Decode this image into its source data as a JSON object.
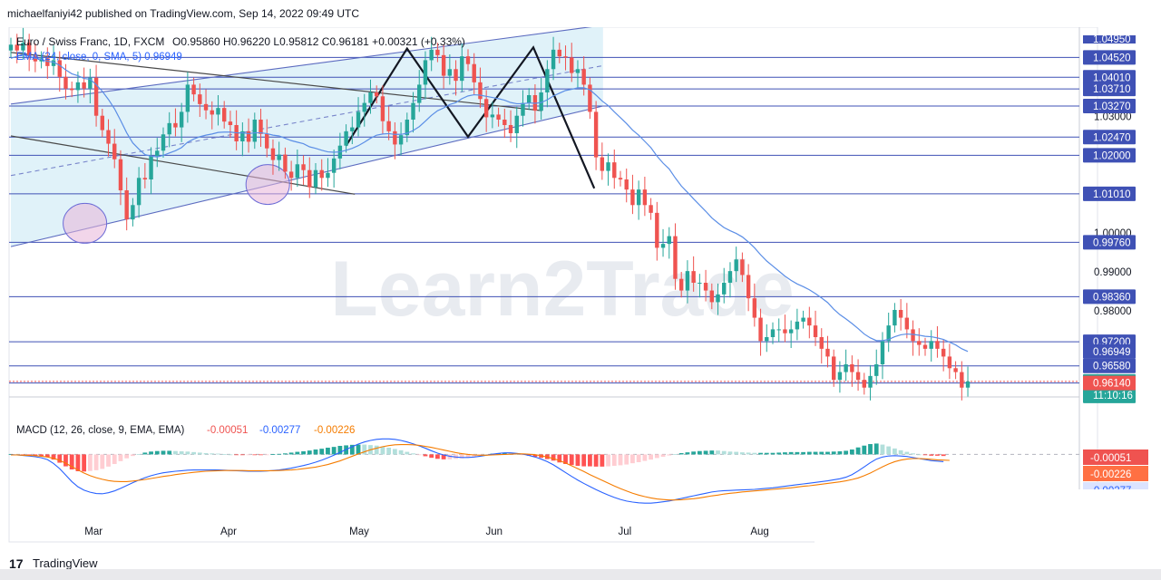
{
  "header": {
    "published": "michaelfaniyi42 published on TradingView.com, Sep 14, 2022 09:49 UTC"
  },
  "footer": {
    "logo": "17",
    "brand": "TradingView"
  },
  "watermark": "Learn2Trade",
  "legend": {
    "symbol": "Euro / Swiss Franc, 1D, FXCM",
    "ohlc": "O0.95860 H0.96220 L0.95812 C0.96181 +0.00321 (+0.33%)",
    "ema": "EMA (24, close, 0, SMA, 5) 0.96949",
    "macd_label": "MACD (12, 26, close, 9, EMA, EMA)",
    "macd_vals": [
      "-0.00051",
      "-0.00277",
      "-0.00226"
    ]
  },
  "colors": {
    "up": "#26a69a",
    "down": "#ef5350",
    "ema": "#5b8ee6",
    "hline": "#3f51b5",
    "channel": "#d6eef7",
    "macd": "#2962ff",
    "signal": "#f57c00"
  },
  "chart_data": [
    {
      "type": "candlestick",
      "title": "Euro / Swiss Franc, 1D, FXCM",
      "currency": "CHF",
      "ylim": [
        0.955,
        1.053
      ],
      "x_labels": [
        "Mar",
        "Apr",
        "May",
        "Jun",
        "Jul",
        "Aug"
      ],
      "x_start": "2022-02-10",
      "y_ticks": [
        1.03,
        1.0,
        0.99,
        0.98
      ],
      "price_levels": [
        1.0452,
        1.0401,
        1.0371,
        1.0327,
        1.0247,
        1.02,
        1.0101,
        0.9976,
        0.9836,
        0.972,
        0.9658,
        0.9614
      ],
      "badges": [
        {
          "label": "1.04950",
          "value": 1.0495,
          "cut": true
        },
        {
          "label": "1.04520",
          "value": 1.0452
        },
        {
          "label": "1.04010",
          "value": 1.0401
        },
        {
          "label": "1.03710",
          "value": 1.0371
        },
        {
          "label": "1.03270",
          "value": 1.0327
        },
        {
          "label": "1.02470",
          "value": 1.0247
        },
        {
          "label": "1.02000",
          "value": 1.02
        },
        {
          "label": "1.01010",
          "value": 1.0101
        },
        {
          "label": "0.99760",
          "value": 0.9976
        },
        {
          "label": "0.98360",
          "value": 0.9836
        },
        {
          "label": "0.97200",
          "value": 0.972
        },
        {
          "label": "0.96949",
          "value": 0.96949
        },
        {
          "label": "0.96580",
          "value": 0.9658
        },
        {
          "label": "0.96181",
          "value": 0.96181,
          "sub": "11:10:16",
          "style": "last"
        },
        {
          "label": "0.96140",
          "value": 0.9614,
          "style": "red"
        }
      ],
      "tick_labels": [
        {
          "label": "1.03000",
          "value": 1.03
        },
        {
          "label": "1.00000",
          "value": 1.0
        },
        {
          "label": "0.99000",
          "value": 0.99
        },
        {
          "label": "0.98000",
          "value": 0.98
        }
      ],
      "closes": [
        1.0485,
        1.047,
        1.049,
        1.0455,
        1.0442,
        1.045,
        1.043,
        1.0445,
        1.0402,
        1.0372,
        1.0368,
        1.0388,
        1.0372,
        1.04,
        1.0302,
        1.0265,
        1.023,
        1.019,
        1.011,
        1.0035,
        1.0072,
        1.0142,
        1.0138,
        1.0198,
        1.0212,
        1.0254,
        1.0283,
        1.0272,
        1.0312,
        1.0382,
        1.0357,
        1.0332,
        1.0316,
        1.0305,
        1.0322,
        1.0287,
        1.0278,
        1.0236,
        1.0262,
        1.0235,
        1.0292,
        1.0255,
        1.0218,
        1.0188,
        1.0202,
        1.0158,
        1.0142,
        1.0177,
        1.0162,
        1.0118,
        1.0162,
        1.0142,
        1.0155,
        1.0192,
        1.0225,
        1.0262,
        1.0272,
        1.0312,
        1.0335,
        1.0362,
        1.0352,
        1.0288,
        1.0262,
        1.0228,
        1.0252,
        1.0292,
        1.0335,
        1.0382,
        1.0445,
        1.0472,
        1.0458,
        1.0405,
        1.0422,
        1.0392,
        1.0455,
        1.0435,
        1.0388,
        1.0345,
        1.0298,
        1.0305,
        1.0292,
        1.0278,
        1.0257,
        1.0302,
        1.0335,
        1.0355,
        1.0315,
        1.0362,
        1.0422,
        1.0472,
        1.0455,
        1.0452,
        1.0412,
        1.0422,
        1.0382,
        1.0312,
        1.0195,
        1.016,
        1.0182,
        1.0142,
        1.0138,
        1.0112,
        1.0072,
        1.0112,
        1.0072,
        1.0052,
        0.9962,
        0.9972,
        0.9992,
        0.9882,
        0.9852,
        0.9902,
        0.9872,
        0.9872,
        0.9852,
        0.9822,
        0.9842,
        0.9872,
        0.9902,
        0.9932,
        0.9892,
        0.9832,
        0.9782,
        0.9722,
        0.9732,
        0.9752,
        0.9752,
        0.9742,
        0.9752,
        0.9772,
        0.9782,
        0.9762,
        0.9732,
        0.9702,
        0.9682,
        0.9622,
        0.9642,
        0.9662,
        0.9642,
        0.9622,
        0.9602,
        0.9632,
        0.9662,
        0.9722,
        0.9762,
        0.9802,
        0.9782,
        0.9752,
        0.9722,
        0.9712,
        0.9702,
        0.9722,
        0.9702,
        0.9682,
        0.9652,
        0.9642,
        0.9602,
        0.9618
      ],
      "ema": [
        1.045,
        1.0455,
        1.046,
        1.0455,
        1.045,
        1.0447,
        1.0442,
        1.044,
        1.0432,
        1.042,
        1.041,
        1.0405,
        1.0398,
        1.0396,
        1.0382,
        1.0365,
        1.0344,
        1.032,
        1.029,
        1.0258,
        1.0232,
        1.0216,
        1.0202,
        1.0198,
        1.0196,
        1.02,
        1.0206,
        1.0212,
        1.022,
        1.0234,
        1.0242,
        1.0248,
        1.0252,
        1.0255,
        1.0259,
        1.026,
        1.026,
        1.0258,
        1.0258,
        1.0256,
        1.0258,
        1.0258,
        1.0256,
        1.0252,
        1.025,
        1.0244,
        1.0238,
        1.0234,
        1.023,
        1.0222,
        1.0218,
        1.0213,
        1.0209,
        1.0208,
        1.0209,
        1.0213,
        1.0218,
        1.0225,
        1.0234,
        1.0244,
        1.0252,
        1.0255,
        1.0256,
        1.0254,
        1.0254,
        1.0257,
        1.0264,
        1.0274,
        1.0288,
        1.0303,
        1.0315,
        1.0322,
        1.0331,
        1.0336,
        1.0346,
        1.0353,
        1.0356,
        1.0355,
        1.0352,
        1.0349,
        1.0346,
        1.0342,
        1.0336,
        1.0333,
        1.0333,
        1.0335,
        1.0334,
        1.0336,
        1.0343,
        1.0353,
        1.036,
        1.0367,
        1.037,
        1.0374,
        1.0374,
        1.0369,
        1.0355,
        1.034,
        1.0328,
        1.0312,
        1.0297,
        1.0282,
        1.0265,
        1.0252,
        1.0236,
        1.022,
        1.0198,
        1.018,
        1.0165,
        1.0142,
        1.0121,
        1.0105,
        1.0088,
        1.0072,
        1.0056,
        1.0039,
        1.0026,
        1.0014,
        1.0006,
        0.9999,
        0.999,
        0.9977,
        0.9962,
        0.9944,
        0.9928,
        0.9915,
        0.9902,
        0.9889,
        0.9878,
        0.9869,
        0.9862,
        0.9854,
        0.9844,
        0.9833,
        0.9821,
        0.9804,
        0.979,
        0.9779,
        0.9767,
        0.9754,
        0.974,
        0.973,
        0.9723,
        0.9723,
        0.9726,
        0.9733,
        0.9738,
        0.974,
        0.9739,
        0.9737,
        0.9734,
        0.9733,
        0.973,
        0.9726,
        0.9719,
        0.9712,
        0.9702,
        0.9695
      ],
      "annotations": {
        "channel_upper": [
          [
            "2022-02-10",
            1.0332
          ],
          [
            "2022-06-26",
            1.0535
          ]
        ],
        "channel_lower": [
          [
            "2022-02-10",
            0.9965
          ],
          [
            "2022-06-26",
            1.0327
          ]
        ],
        "channel_mid": [
          [
            "2022-02-10",
            1.0148
          ],
          [
            "2022-06-26",
            1.0431
          ]
        ],
        "trend_down": [
          [
            "2022-02-10",
            1.025
          ],
          [
            "2022-04-30",
            1.01
          ]
        ],
        "trend_top": [
          [
            "2022-02-10",
            1.0465
          ],
          [
            "2022-06-12",
            1.0315
          ]
        ],
        "circles": [
          {
            "x": "2022-02-27",
            "y": 1.0025
          },
          {
            "x": "2022-04-10",
            "y": 1.0125
          }
        ],
        "zigzag": [
          [
            "2022-04-28",
            1.0225
          ],
          [
            "2022-05-12",
            1.0475
          ],
          [
            "2022-05-26",
            1.0248
          ],
          [
            "2022-06-10",
            1.0478
          ],
          [
            "2022-06-24",
            1.0115
          ]
        ]
      }
    },
    {
      "type": "macd",
      "title": "MACD (12, 26, close, 9, EMA, EMA)",
      "ylim": [
        -0.024,
        0.011
      ],
      "badges": [
        {
          "label": "-0.00051",
          "value": -0.00051,
          "style": "down"
        },
        {
          "label": "-0.00226",
          "value": -0.00226,
          "style": "orange"
        },
        {
          "label": "-0.00277",
          "value": -0.00277,
          "style": "blue"
        }
      ],
      "macd": [
        -0.0001,
        -0.0002,
        -0.0004,
        -0.0006,
        -0.0009,
        -0.0013,
        -0.002,
        -0.0035,
        -0.0055,
        -0.008,
        -0.0105,
        -0.0125,
        -0.0138,
        -0.0146,
        -0.0151,
        -0.0152,
        -0.0148,
        -0.0141,
        -0.0131,
        -0.012,
        -0.0109,
        -0.0099,
        -0.009,
        -0.0082,
        -0.0076,
        -0.0071,
        -0.0068,
        -0.0065,
        -0.0063,
        -0.0061,
        -0.006,
        -0.006,
        -0.006,
        -0.006,
        -0.006,
        -0.0061,
        -0.0062,
        -0.0063,
        -0.0064,
        -0.0065,
        -0.0065,
        -0.0065,
        -0.0064,
        -0.0062,
        -0.006,
        -0.0057,
        -0.0053,
        -0.0048,
        -0.0043,
        -0.0037,
        -0.003,
        -0.0022,
        -0.0013,
        -0.0003,
        0.0008,
        0.0019,
        0.003,
        0.004,
        0.0048,
        0.0054,
        0.0058,
        0.006,
        0.006,
        0.0058,
        0.0054,
        0.0048,
        0.0041,
        0.0033,
        0.0024,
        0.0014,
        0.0005,
        -0.0002,
        -0.0007,
        -0.001,
        -0.0012,
        -0.0012,
        -0.001,
        -0.0007,
        -0.0003,
        0.0001,
        0.0004,
        0.0006,
        0.0006,
        0.0004,
        0.0001,
        -0.0004,
        -0.001,
        -0.0018,
        -0.0028,
        -0.004,
        -0.0055,
        -0.007,
        -0.0085,
        -0.0099,
        -0.0112,
        -0.0124,
        -0.0136,
        -0.0147,
        -0.0157,
        -0.0166,
        -0.0174,
        -0.018,
        -0.0184,
        -0.0187,
        -0.0188,
        -0.0188,
        -0.0186,
        -0.0183,
        -0.018,
        -0.0175,
        -0.017,
        -0.0165,
        -0.016,
        -0.0155,
        -0.015,
        -0.0145,
        -0.0142,
        -0.014,
        -0.0139,
        -0.0138,
        -0.0137,
        -0.0136,
        -0.0135,
        -0.0133,
        -0.0131,
        -0.0129,
        -0.0126,
        -0.0123,
        -0.012,
        -0.0117,
        -0.0114,
        -0.0111,
        -0.0108,
        -0.0105,
        -0.0102,
        -0.0098,
        -0.0094,
        -0.0088,
        -0.0078,
        -0.0064,
        -0.0048,
        -0.0032,
        -0.0018,
        -0.001,
        -0.0006,
        -0.0005,
        -0.0006,
        -0.0008,
        -0.0012,
        -0.0016,
        -0.002,
        -0.0024,
        -0.0026,
        -0.0028
      ],
      "signal": [
        -0.0002,
        -0.0002,
        -0.0003,
        -0.0004,
        -0.0005,
        -0.0007,
        -0.001,
        -0.0015,
        -0.0023,
        -0.0034,
        -0.0047,
        -0.006,
        -0.0072,
        -0.0082,
        -0.009,
        -0.0096,
        -0.0101,
        -0.0104,
        -0.0105,
        -0.0105,
        -0.0103,
        -0.01,
        -0.0097,
        -0.0093,
        -0.0089,
        -0.0085,
        -0.0082,
        -0.0078,
        -0.0075,
        -0.0072,
        -0.0069,
        -0.0067,
        -0.0065,
        -0.0064,
        -0.0063,
        -0.0062,
        -0.0062,
        -0.0062,
        -0.0062,
        -0.0063,
        -0.0063,
        -0.0063,
        -0.0063,
        -0.0063,
        -0.0062,
        -0.0061,
        -0.006,
        -0.0058,
        -0.0055,
        -0.0052,
        -0.0049,
        -0.0044,
        -0.0039,
        -0.0032,
        -0.0025,
        -0.0016,
        -0.0007,
        0.0002,
        0.001,
        0.0018,
        0.0024,
        0.003,
        0.0034,
        0.0037,
        0.0038,
        0.0038,
        0.0037,
        0.0035,
        0.0031,
        0.0027,
        0.0022,
        0.0017,
        0.0012,
        0.0007,
        0.0003,
        0.0,
        -0.0002,
        -0.0003,
        -0.0003,
        -0.0002,
        -0.0001,
        0.0,
        0.0001,
        0.0002,
        0.0002,
        0.0001,
        -0.0001,
        -0.0005,
        -0.001,
        -0.0016,
        -0.0024,
        -0.0033,
        -0.0044,
        -0.0055,
        -0.0066,
        -0.0078,
        -0.0089,
        -0.01,
        -0.0111,
        -0.0122,
        -0.0132,
        -0.0141,
        -0.015,
        -0.0157,
        -0.0163,
        -0.0168,
        -0.0172,
        -0.0174,
        -0.0176,
        -0.0176,
        -0.0175,
        -0.0173,
        -0.0171,
        -0.0168,
        -0.0164,
        -0.016,
        -0.0157,
        -0.0153,
        -0.015,
        -0.0148,
        -0.0145,
        -0.0143,
        -0.0141,
        -0.0139,
        -0.0137,
        -0.0135,
        -0.0133,
        -0.0131,
        -0.0129,
        -0.0126,
        -0.0123,
        -0.0121,
        -0.0118,
        -0.0115,
        -0.0112,
        -0.0109,
        -0.0106,
        -0.0102,
        -0.0097,
        -0.0091,
        -0.0082,
        -0.0072,
        -0.006,
        -0.0048,
        -0.0037,
        -0.0028,
        -0.0022,
        -0.0018,
        -0.0016,
        -0.0016,
        -0.0017,
        -0.0019,
        -0.0021,
        -0.0022,
        -0.0023
      ]
    }
  ]
}
